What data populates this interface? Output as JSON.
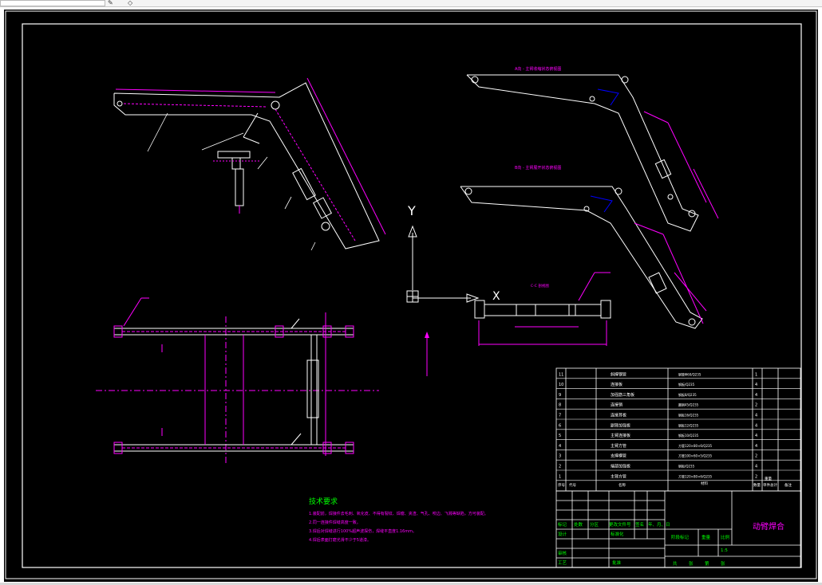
{
  "toolbar": {
    "icons": [
      "pencil-icon",
      "layers-icon"
    ]
  },
  "drawing": {
    "title_top_view_1": "A向 - 主臂收缩状态俯视图",
    "title_top_view_2": "B向 - 主臂展开状态俯视图",
    "title_section": "C-C 剖视图",
    "axis_y_label": "Y",
    "axis_x_label": "X",
    "tech_title": "技术要求",
    "tech_items": [
      "1.装配前，焊接件去毛刺、氧化皮、不得有裂纹、焊瘤、夹渣、气孔、咬边、飞溅等缺陷，方可装配。",
      "2.同一连接件焊缝高度一致。",
      "3.焊后对焊缝进行100%超声波探伤，焊缝平直度1.16mm。",
      "4.焊后表面打磨光滑不少于5道漆。"
    ],
    "accent_color": "#ff00ff",
    "line_color": "#ffffff",
    "text_color": "#00ff00"
  },
  "bom": {
    "rows": [
      {
        "no": "11",
        "name": "斜撑钢管",
        "material": "钢管Φ60/Q235",
        "qty": "1"
      },
      {
        "no": "10",
        "name": "连接板",
        "material": "钢板/Q235",
        "qty": "4"
      },
      {
        "no": "9",
        "name": "加强筋三角板",
        "material": "钢板8/Q235",
        "qty": "4"
      },
      {
        "no": "8",
        "name": "连接销",
        "material": "圆钢45/Q235",
        "qty": "2"
      },
      {
        "no": "7",
        "name": "连接耳板",
        "material": "钢板16/Q235",
        "qty": "4"
      },
      {
        "no": "6",
        "name": "副臂加强板",
        "material": "钢板12/Q235",
        "qty": "4"
      },
      {
        "no": "5",
        "name": "主臂连接板",
        "material": "钢板10/Q235",
        "qty": "4"
      },
      {
        "no": "4",
        "name": "主臂方管",
        "material": "方管120×80×6/Q235",
        "qty": "4"
      },
      {
        "no": "3",
        "name": "支撑横管",
        "material": "方管100×60×5/Q235",
        "qty": "2"
      },
      {
        "no": "2",
        "name": "端部加强板",
        "material": "钢板/Q235",
        "qty": "4"
      },
      {
        "no": "1",
        "name": "主臂方管",
        "material": "方管120×80×6/Q235",
        "qty": "2"
      }
    ],
    "header": {
      "no": "序号",
      "code": "代号",
      "name": "名称",
      "qty": "数量",
      "material": "材料",
      "single": "单件",
      "total": "总计",
      "weight": "重量",
      "remark": "备注"
    }
  },
  "title_block": {
    "drawing_name": "动臂焊合",
    "scale": "1:5",
    "row_labels": [
      "标记",
      "处数",
      "分区",
      "更改文件号",
      "签名",
      "年、月、日"
    ],
    "design": "设计",
    "standard": "标准化",
    "check": "审核",
    "process": "工艺",
    "approve": "批准",
    "stage_mark": "阶段标记",
    "weight": "重量",
    "scale_label": "比例",
    "sheets": [
      "共",
      "张",
      "第",
      "张"
    ]
  }
}
